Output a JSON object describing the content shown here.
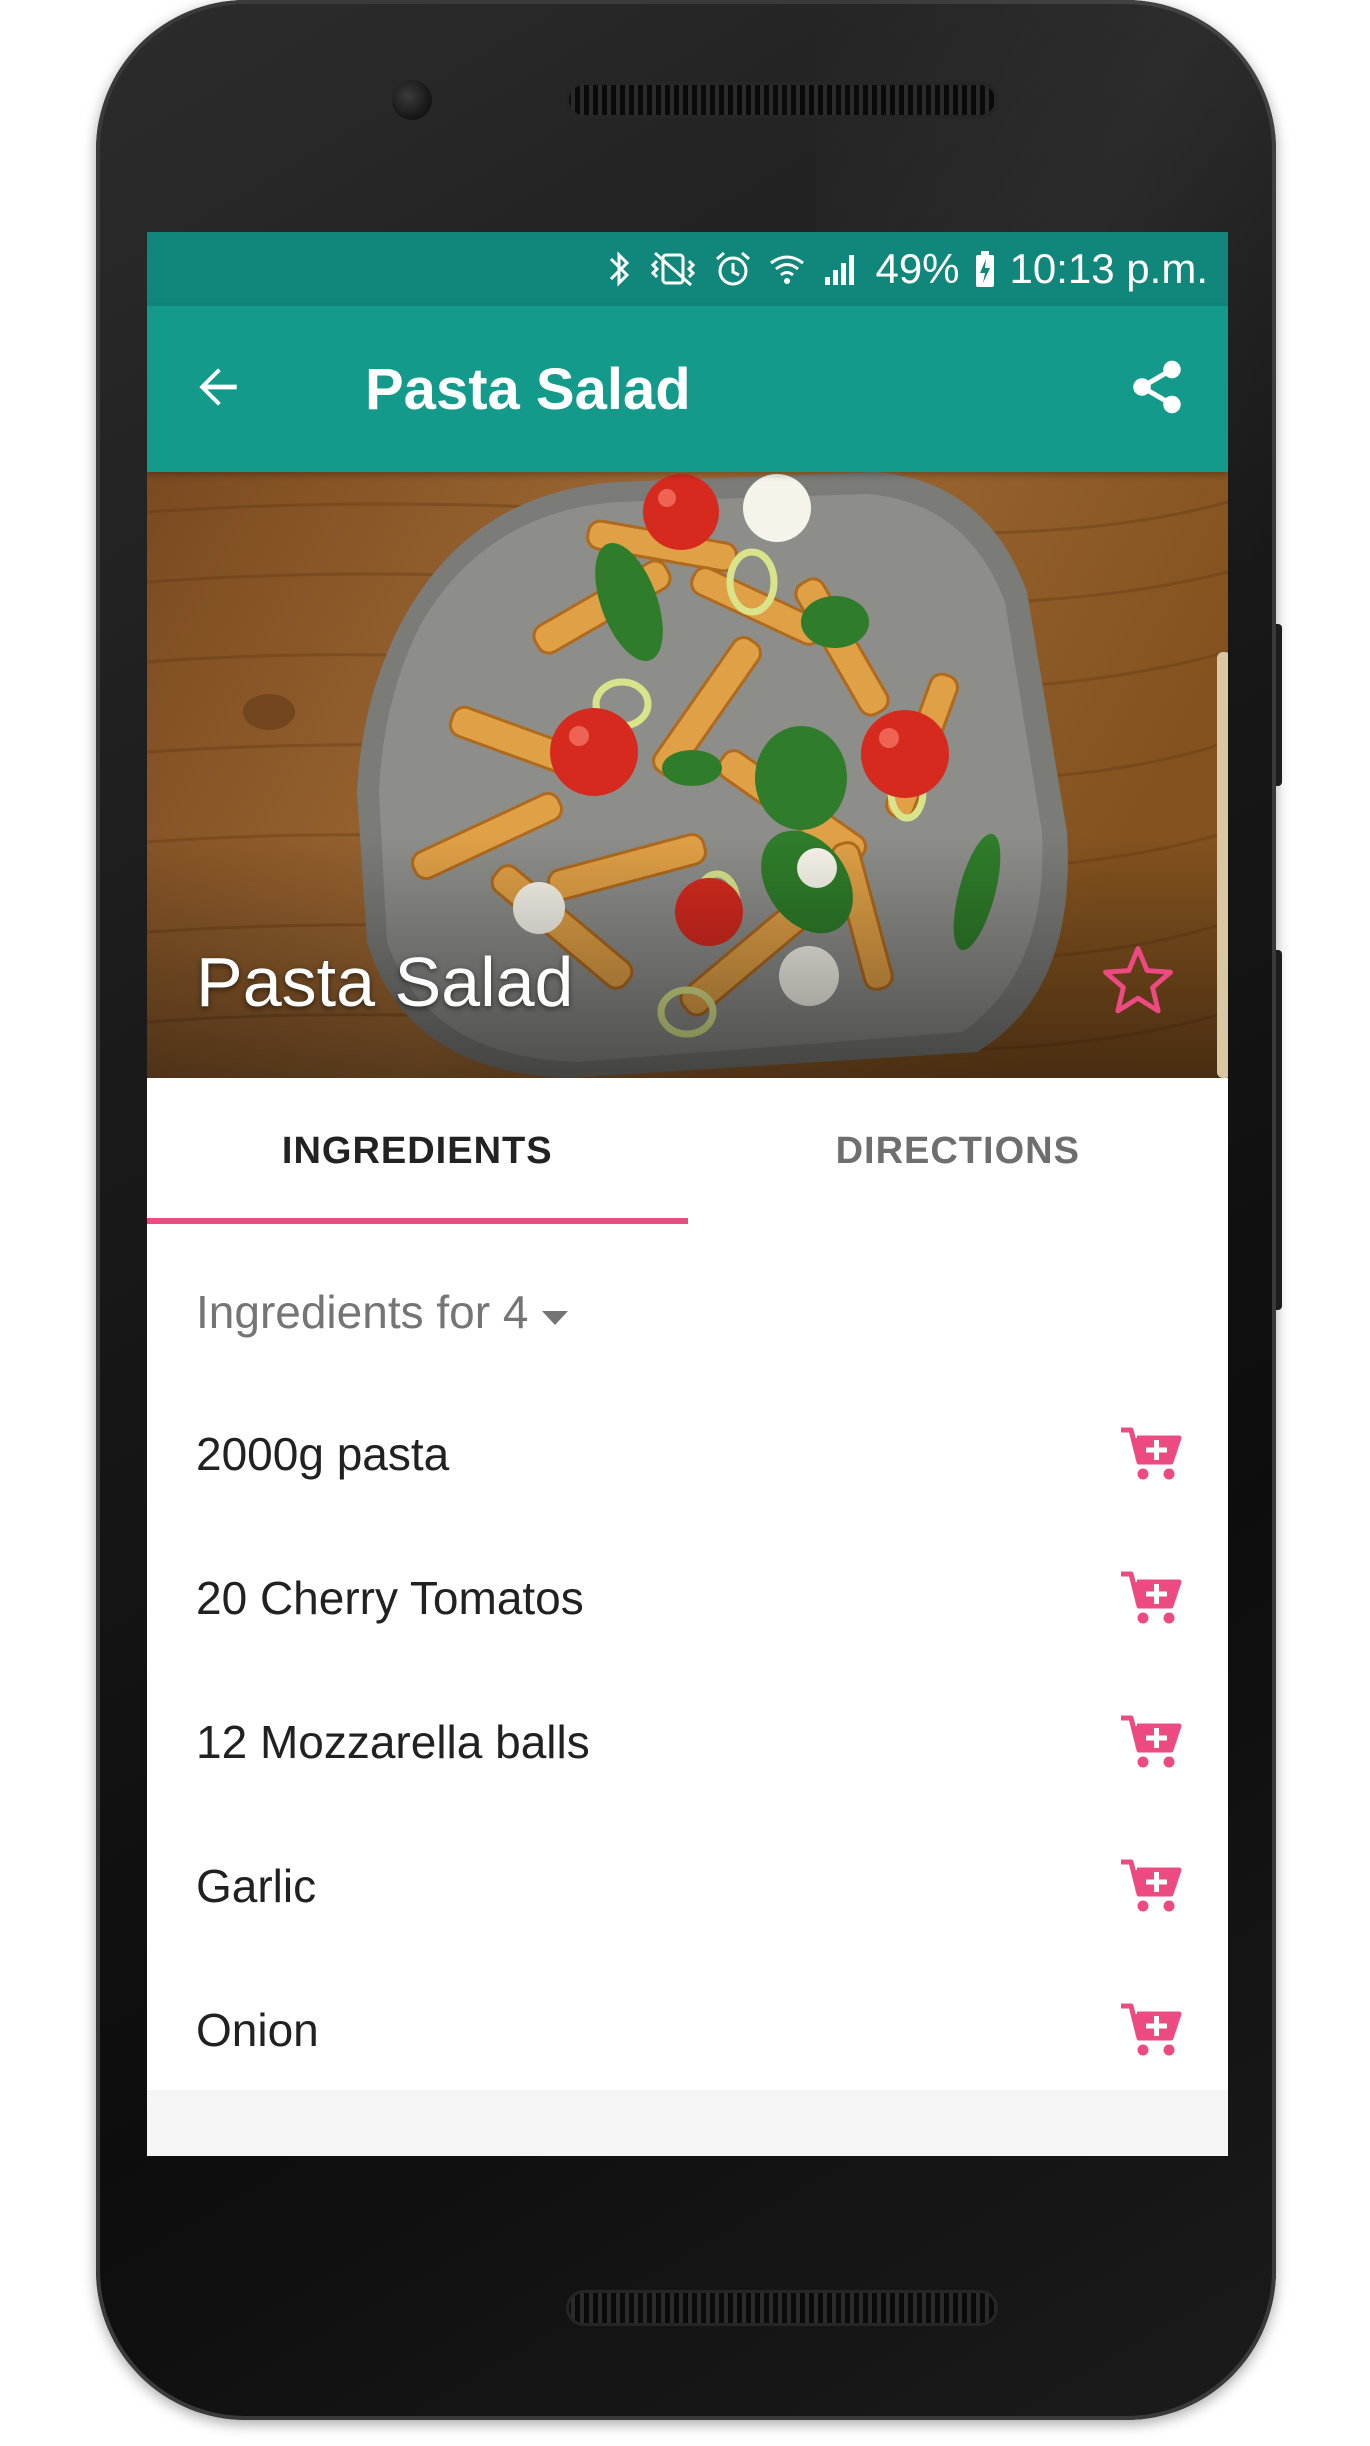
{
  "status_bar": {
    "battery": "49%",
    "time": "10:13 p.m.",
    "icons": [
      "bluetooth-icon",
      "vibrate-icon",
      "alarm-icon",
      "wifi-icon",
      "signal-icon",
      "battery-charging-icon"
    ]
  },
  "app_bar": {
    "title": "Pasta Salad",
    "back_icon": "arrow-back-icon",
    "share_icon": "share-icon"
  },
  "hero": {
    "title": "Pasta Salad",
    "favorite_icon": "star-outline-icon"
  },
  "tabs": [
    {
      "label": "INGREDIENTS",
      "active": true
    },
    {
      "label": "DIRECTIONS",
      "active": false
    }
  ],
  "servings": {
    "label": "Ingredients for 4"
  },
  "ingredients": [
    {
      "text": "2000g pasta"
    },
    {
      "text": "20 Cherry Tomatos"
    },
    {
      "text": "12 Mozzarella balls"
    },
    {
      "text": "Garlic"
    },
    {
      "text": "Onion"
    }
  ],
  "colors": {
    "primary": "#139a8b",
    "primary_dark": "#10877a",
    "accent": "#ee4a82"
  }
}
